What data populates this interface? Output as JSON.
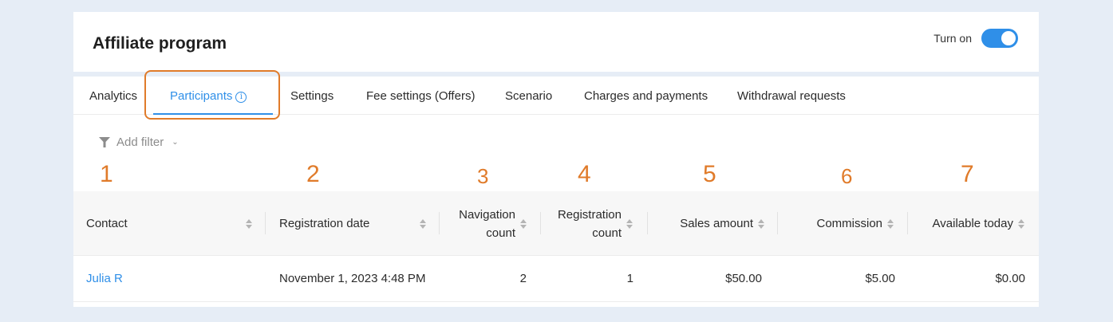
{
  "header": {
    "title": "Affiliate program",
    "toggle_label": "Turn on",
    "toggle_on": true
  },
  "tabs": [
    {
      "label": "Analytics"
    },
    {
      "label": "Participants",
      "active": true,
      "icon": "info-icon"
    },
    {
      "label": "Settings"
    },
    {
      "label": "Fee settings (Offers)"
    },
    {
      "label": "Scenario"
    },
    {
      "label": "Charges and payments"
    },
    {
      "label": "Withdrawal requests"
    }
  ],
  "filter": {
    "label": "Add filter",
    "icon": "funnel-icon"
  },
  "annotations": [
    "1",
    "2",
    "3",
    "4",
    "5",
    "6",
    "7"
  ],
  "table": {
    "columns": [
      {
        "label": "Contact"
      },
      {
        "label": "Registration date"
      },
      {
        "label_line1": "Navigation",
        "label_line2": "count"
      },
      {
        "label_line1": "Registration",
        "label_line2": "count"
      },
      {
        "label": "Sales amount"
      },
      {
        "label": "Commission"
      },
      {
        "label": "Available today"
      }
    ],
    "rows": [
      {
        "contact": "Julia R",
        "registration_date": "November 1, 2023 4:48 PM",
        "navigation_count": "2",
        "registration_count": "1",
        "sales_amount": "$50.00",
        "commission": "$5.00",
        "available_today": "$0.00"
      }
    ]
  },
  "colors": {
    "accent": "#2f8fe8",
    "annotation": "#e07b2a"
  }
}
